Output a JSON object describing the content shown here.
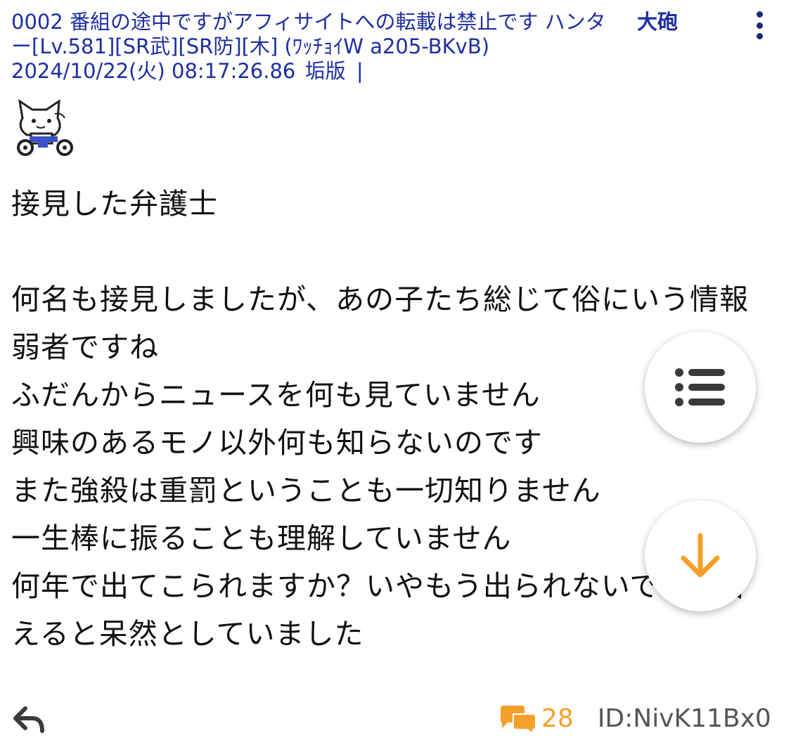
{
  "post": {
    "header_text": "0002 番組の途中ですがアフィサイトへの転載は禁止です ハンター[Lv.581][SR武][SR防][木] (ﾜｯﾁｮｲW a205-BKvB) 2024/10/22(火) 08:17:26.86",
    "badge": "垢版",
    "separator": "|",
    "rank": "大砲",
    "body": "接見した弁護士\n\n何名も接見しましたが、あの子たち総じて俗にいう情報弱者ですね\nふだんからニュースを何も見ていません\n興味のあるモノ以外何も知らないのです\nまた強殺は重罰ということも一切知りません\n一生棒に振ることも理解していません\n何年で出てこられますか？いやもう出られないですと答えると呆然としていました",
    "reply_count": "28",
    "user_id": "ID:NivK11Bx0"
  },
  "colors": {
    "header_text": "#1e2fa0",
    "body_text": "#111111",
    "accent_orange": "#f5a02a",
    "icon_dark": "#3a3a3a"
  },
  "icons": [
    "more-vert-icon",
    "cat-bike-avatar",
    "list-icon",
    "arrow-down-icon",
    "reply-icon",
    "comments-icon"
  ]
}
